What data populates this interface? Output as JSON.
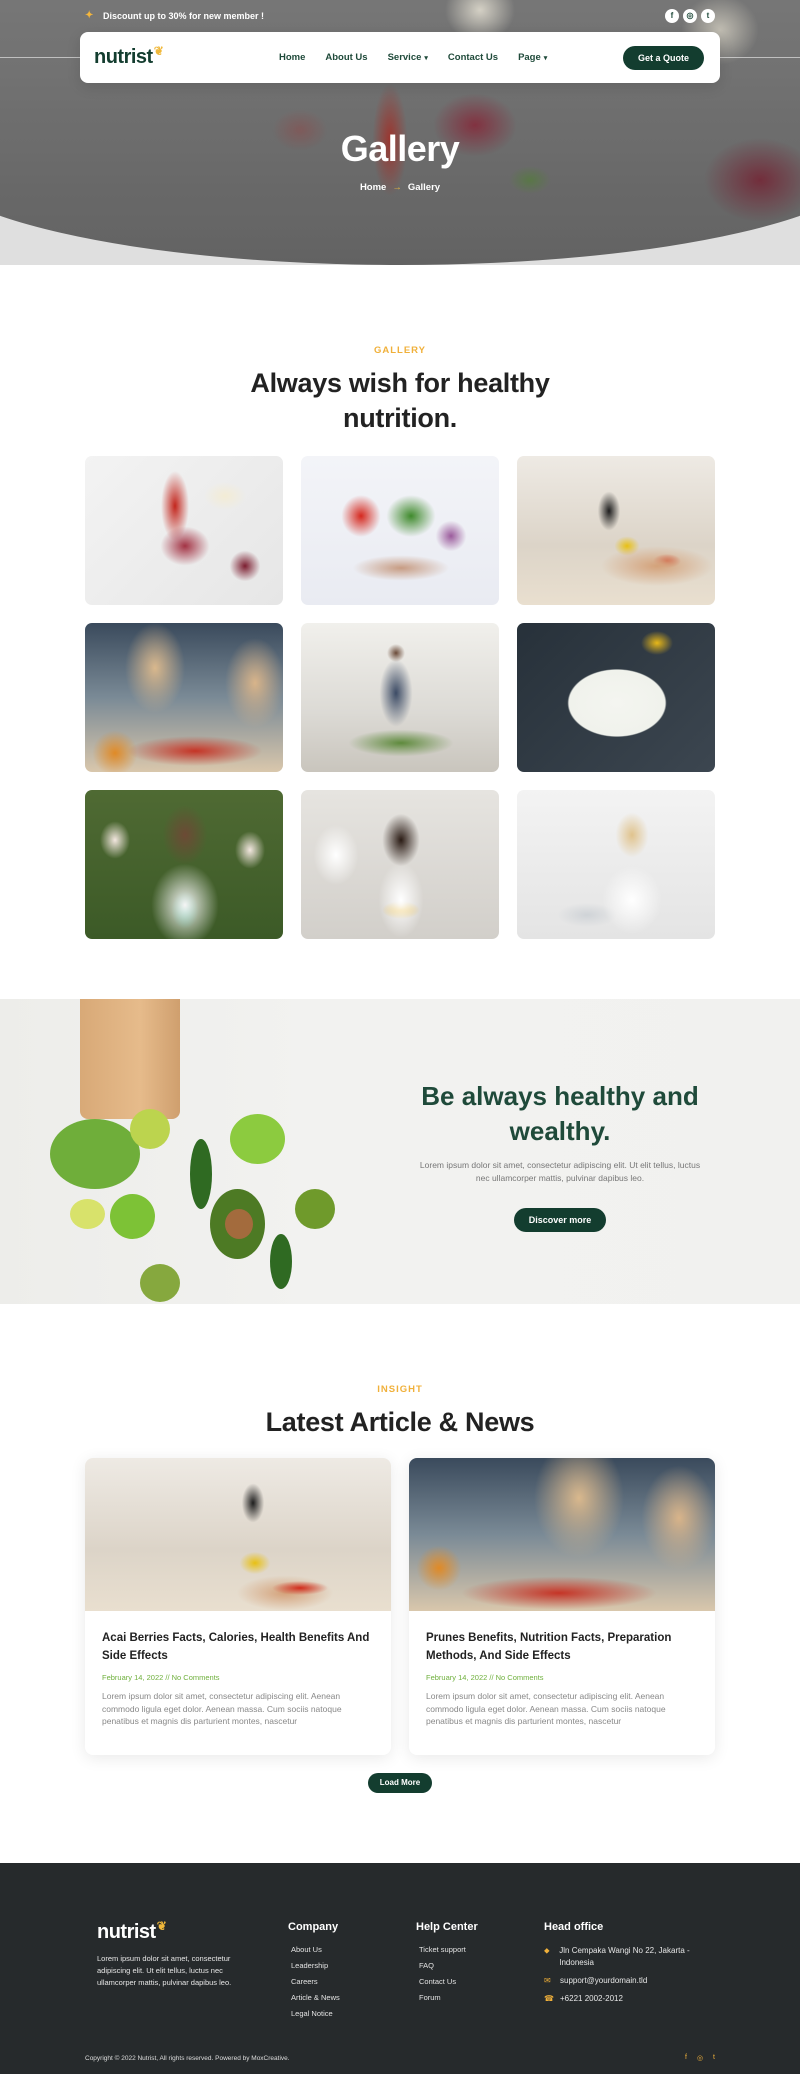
{
  "topbar": {
    "promo_text": "Discount up to 30% for new member !",
    "promo_icon": "tag-icon",
    "socials": [
      {
        "icon": "facebook-icon",
        "glyph": "f"
      },
      {
        "icon": "instagram-icon",
        "glyph": "◎"
      },
      {
        "icon": "twitter-icon",
        "glyph": "t"
      }
    ]
  },
  "nav": {
    "logo": "nutrist",
    "links": [
      {
        "label": "Home",
        "dropdown": false
      },
      {
        "label": "About Us",
        "dropdown": false
      },
      {
        "label": "Service",
        "dropdown": true
      },
      {
        "label": "Contact Us",
        "dropdown": false
      },
      {
        "label": "Page",
        "dropdown": true
      }
    ],
    "cta": "Get a Quote"
  },
  "hero": {
    "title": "Gallery",
    "crumbs": [
      "Home",
      "Gallery"
    ]
  },
  "gallery": {
    "tag": "GALLERY",
    "title": "Always wish for healthy nutrition."
  },
  "promo": {
    "title": "Be always healthy and wealthy.",
    "text": "Lorem ipsum dolor sit amet, consectetur adipiscing elit. Ut elit tellus, luctus nec ullamcorper mattis, pulvinar dapibus leo.",
    "button": "Discover more"
  },
  "news": {
    "tag": "INSIGHT",
    "title": "Latest Article & News",
    "cards": [
      {
        "title": "Acai Berries Facts, Calories, Health Benefits And Side Effects",
        "meta": "February 14, 2022 // No Comments",
        "text": "Lorem ipsum dolor sit amet, consectetur adipiscing elit. Aenean commodo ligula eget dolor. Aenean massa. Cum sociis natoque penatibus et magnis dis parturient montes, nascetur"
      },
      {
        "title": "Prunes Benefits, Nutrition Facts, Preparation Methods, And Side Effects",
        "meta": "February 14, 2022 // No Comments",
        "text": "Lorem ipsum dolor sit amet, consectetur adipiscing elit. Aenean commodo ligula eget dolor. Aenean massa. Cum sociis natoque penatibus et magnis dis parturient montes, nascetur"
      }
    ],
    "load_more": "Load More"
  },
  "footer": {
    "logo": "nutrist",
    "about": "Lorem ipsum dolor sit amet, consectetur adipiscing elit. Ut elit tellus, luctus nec ullamcorper mattis, pulvinar dapibus leo.",
    "company": {
      "title": "Company",
      "links": [
        "About Us",
        "Leadership",
        "Careers",
        "Article & News",
        "Legal Notice"
      ]
    },
    "help": {
      "title": "Help Center",
      "links": [
        "Ticket support",
        "FAQ",
        "Contact Us",
        "Forum"
      ]
    },
    "office": {
      "title": "Head office",
      "address": "Jln Cempaka Wangi No 22, Jakarta - Indonesia",
      "email": "support@yourdomain.tld",
      "phone": "+6221 2002-2012"
    },
    "copyright": "Copyright © 2022 Nutrist, All rights reserved. Powered by MoxCreative.",
    "socials": [
      "f",
      "◎",
      "t"
    ]
  },
  "colors": {
    "brand_dark": "#133d2f",
    "accent": "#f0b03a",
    "meta_green": "#6fb03d",
    "footer_bg": "#262a2c"
  }
}
